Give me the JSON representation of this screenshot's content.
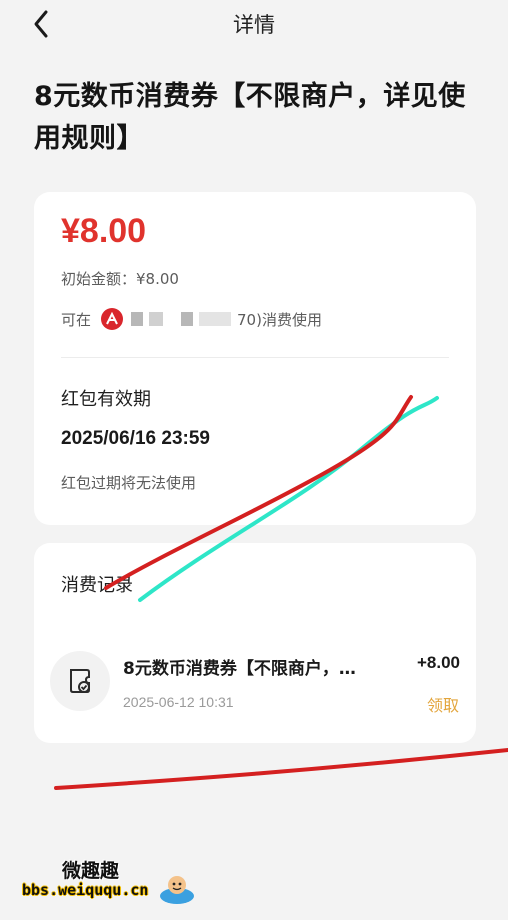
{
  "nav": {
    "title": "详情"
  },
  "page": {
    "title": "8元数币消费券【不限商户，详见使用规则】"
  },
  "voucher": {
    "amount": "¥8.00",
    "initial_amount": "初始金额：¥8.00",
    "usable_prefix": "可在",
    "usable_suffix": "70)消费使用",
    "validity_label": "红包有效期",
    "validity_date": "2025/06/16 23:59",
    "validity_note": "红包过期将无法使用"
  },
  "records": {
    "label": "消费记录",
    "items": [
      {
        "name": "8元数币消费券【不限商户，…",
        "amount": "+8.00",
        "time": "2025-06-12 10:31",
        "status": "领取",
        "icon": "voucher-check-icon"
      }
    ]
  },
  "watermark": {
    "brand": "微趣趣",
    "url": "bbs.weiququ.cn"
  },
  "colors": {
    "accent_red": "#e0332d",
    "status_gold": "#e3a53c",
    "scribble_red": "#d42020",
    "scribble_cyan": "#2ee6c8"
  }
}
